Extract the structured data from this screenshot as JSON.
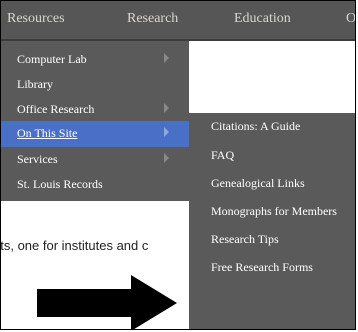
{
  "nav": {
    "items": [
      "Resources",
      "Research",
      "Education",
      "O"
    ]
  },
  "menu1": {
    "items": [
      {
        "label": "Computer Lab",
        "has_submenu": true
      },
      {
        "label": "Library",
        "has_submenu": false
      },
      {
        "label": "Office Research",
        "has_submenu": true
      },
      {
        "label": "On This Site",
        "has_submenu": true,
        "active": true
      },
      {
        "label": "Services",
        "has_submenu": true
      },
      {
        "label": "St. Louis Records",
        "has_submenu": false
      }
    ]
  },
  "menu2": {
    "items": [
      {
        "label": "Citations: A Guide"
      },
      {
        "label": "FAQ"
      },
      {
        "label": "Genealogical Links"
      },
      {
        "label": "Monographs for Members"
      },
      {
        "label": "Research Tips"
      },
      {
        "label": "Free Research Forms"
      }
    ]
  },
  "page": {
    "background_text": "nts, one for institutes and c"
  },
  "colors": {
    "nav_bg": "#565656",
    "menu_bg": "#5a5a5a",
    "active_bg": "#4a6fc7",
    "arrow": "#000000"
  },
  "icons": {
    "submenu": "chevron-right-icon",
    "overlay": "right-arrow-icon"
  }
}
